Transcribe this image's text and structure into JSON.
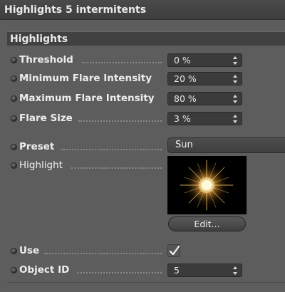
{
  "window": {
    "title": "Highlights 5 intermitents"
  },
  "section": {
    "title": "Highlights"
  },
  "fields": [
    {
      "label": "Threshold",
      "value": "0 %"
    },
    {
      "label": "Minimum Flare Intensity",
      "value": "20 %"
    },
    {
      "label": "Maximum Flare Intensity",
      "value": "80 %"
    },
    {
      "label": "Flare Size",
      "value": "3 %"
    }
  ],
  "preset": {
    "label": "Preset",
    "value": "Sun"
  },
  "highlight": {
    "label": "Highlight",
    "preview_icon": "sun-flare-icon",
    "edit_label": "Edit..."
  },
  "use": {
    "label": "Use",
    "checked": true
  },
  "object_id": {
    "label": "Object ID",
    "value": "5"
  },
  "colors": {
    "panel_bg": "#5d5d5d",
    "header_bg": "#414141",
    "field_bg": "#3b3b3b",
    "flare_core": "#fff6d8",
    "flare_glow": "#ffb347"
  }
}
